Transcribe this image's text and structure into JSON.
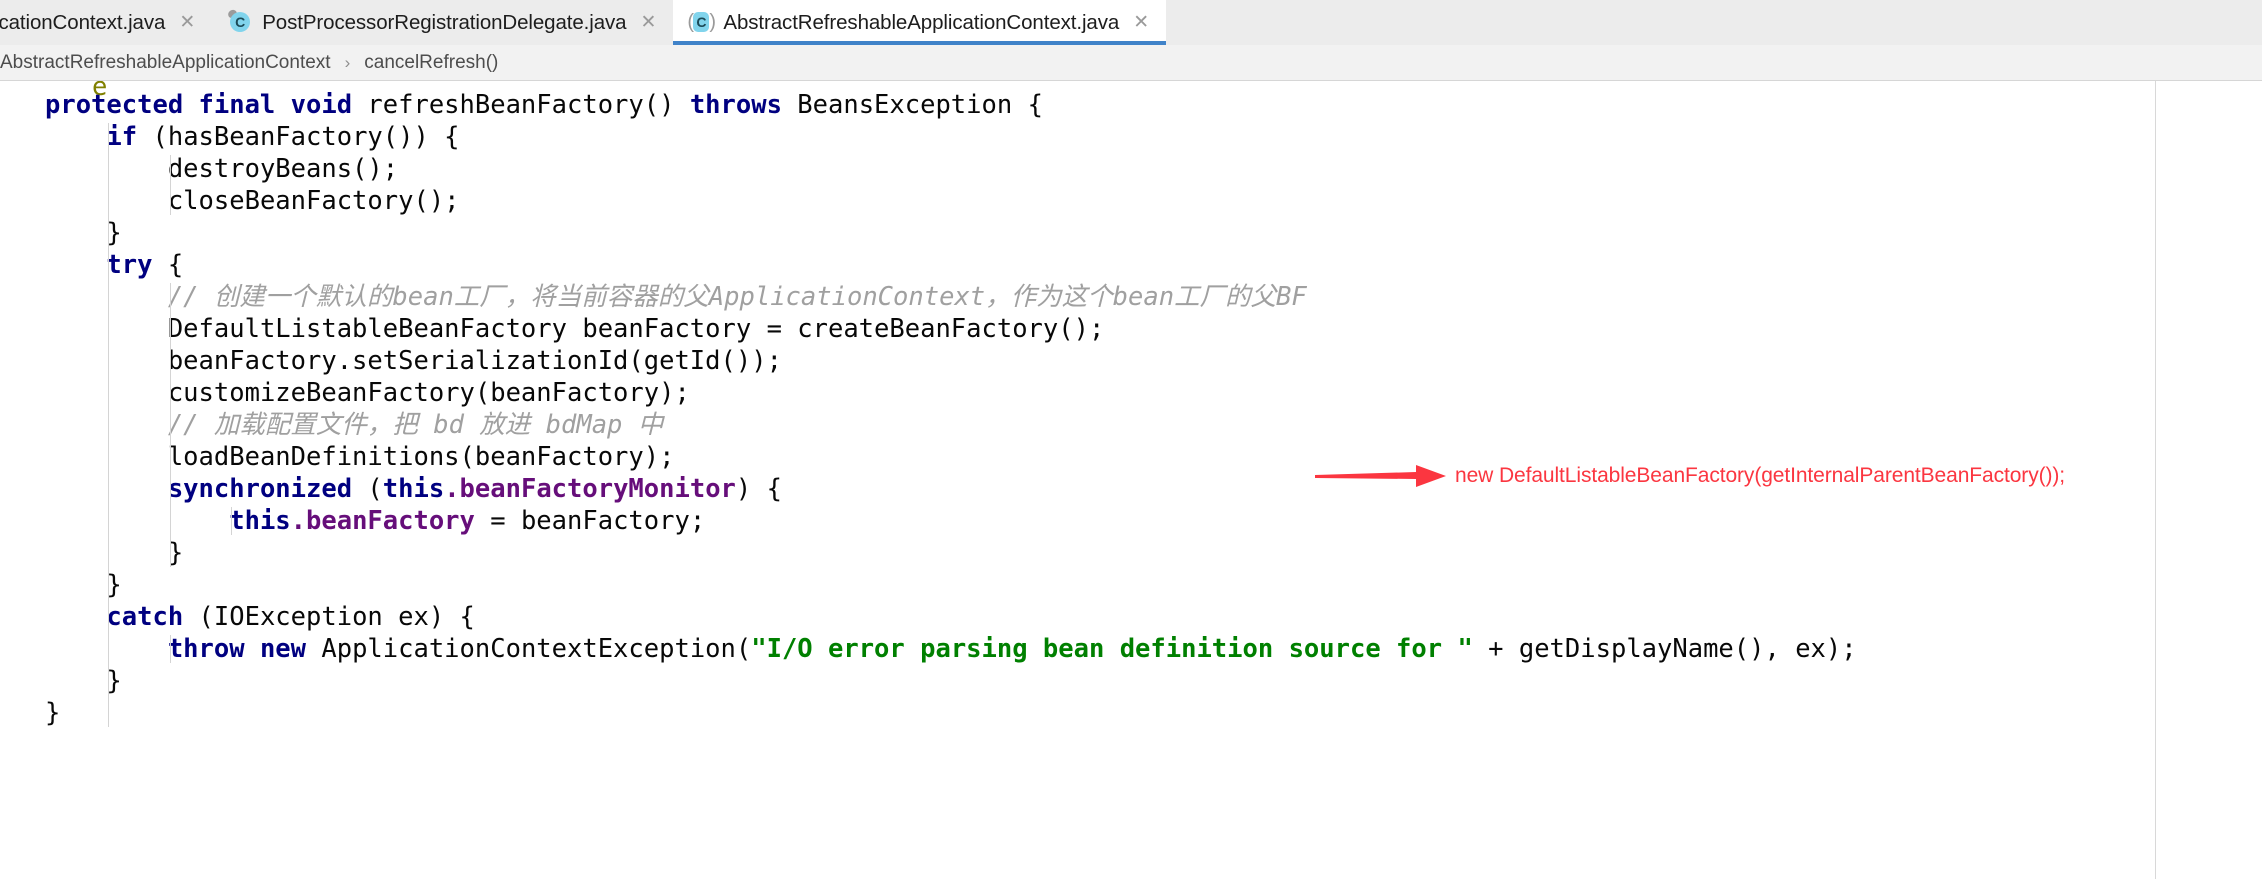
{
  "window": {
    "title": "AbstractRefreshableApplicationContext.java"
  },
  "tabs": [
    {
      "label": "icationContext.java",
      "icon": "java-class-icon",
      "close_label": "✕",
      "active": false,
      "clipped": true
    },
    {
      "label": "PostProcessorRegistrationDelegate.java",
      "icon": "java-class-icon",
      "close_label": "✕",
      "active": false,
      "clipped": false
    },
    {
      "label": "AbstractRefreshableApplicationContext.java",
      "icon": "java-abstract-class-icon",
      "close_label": "✕",
      "active": true,
      "clipped": false
    }
  ],
  "breadcrumb": {
    "separator": "›",
    "items": [
      "AbstractRefreshableApplicationContext",
      "cancelRefresh()"
    ]
  },
  "code": {
    "top_partial_glyph": "e",
    "lines": [
      {
        "indent": 0,
        "tokens": [
          {
            "t": "protected final void ",
            "c": "kw"
          },
          {
            "t": "refreshBeanFactory() ",
            "c": "plain"
          },
          {
            "t": "throws ",
            "c": "kw"
          },
          {
            "t": "BeansException {",
            "c": "plain"
          }
        ]
      },
      {
        "indent": 1,
        "tokens": [
          {
            "t": "if ",
            "c": "kw"
          },
          {
            "t": "(hasBeanFactory()) {",
            "c": "plain"
          }
        ]
      },
      {
        "indent": 2,
        "tokens": [
          {
            "t": "destroyBeans();",
            "c": "plain"
          }
        ]
      },
      {
        "indent": 2,
        "tokens": [
          {
            "t": "closeBeanFactory();",
            "c": "plain"
          }
        ]
      },
      {
        "indent": 1,
        "tokens": [
          {
            "t": "}",
            "c": "plain"
          }
        ]
      },
      {
        "indent": 1,
        "tokens": [
          {
            "t": "try ",
            "c": "kw"
          },
          {
            "t": "{",
            "c": "plain"
          }
        ]
      },
      {
        "indent": 2,
        "tokens": [
          {
            "t": "// 创建一个默认的bean工厂，将当前容器的父ApplicationContext，作为这个bean工厂的父BF",
            "c": "cmt"
          }
        ]
      },
      {
        "indent": 2,
        "tokens": [
          {
            "t": "DefaultListableBeanFactory beanFactory = createBeanFactory();",
            "c": "plain"
          }
        ]
      },
      {
        "indent": 2,
        "tokens": [
          {
            "t": "beanFactory.setSerializationId(getId());",
            "c": "plain"
          }
        ]
      },
      {
        "indent": 2,
        "tokens": [
          {
            "t": "customizeBeanFactory(beanFactory);",
            "c": "plain"
          }
        ]
      },
      {
        "indent": 2,
        "tokens": [
          {
            "t": "// 加载配置文件，把 bd 放进 bdMap 中",
            "c": "cmt"
          }
        ]
      },
      {
        "indent": 2,
        "tokens": [
          {
            "t": "loadBeanDefinitions(beanFactory);",
            "c": "plain"
          }
        ]
      },
      {
        "indent": 2,
        "tokens": [
          {
            "t": "synchronized ",
            "c": "kw"
          },
          {
            "t": "(",
            "c": "plain"
          },
          {
            "t": "this",
            "c": "kw"
          },
          {
            "t": ".beanFactoryMonitor",
            "c": "fld"
          },
          {
            "t": ") {",
            "c": "plain"
          }
        ]
      },
      {
        "indent": 3,
        "tokens": [
          {
            "t": "this",
            "c": "kw"
          },
          {
            "t": ".beanFactory ",
            "c": "fld"
          },
          {
            "t": "= beanFactory;",
            "c": "plain"
          }
        ]
      },
      {
        "indent": 2,
        "tokens": [
          {
            "t": "}",
            "c": "plain"
          }
        ]
      },
      {
        "indent": 1,
        "tokens": [
          {
            "t": "}",
            "c": "plain"
          }
        ]
      },
      {
        "indent": 1,
        "tokens": [
          {
            "t": "catch ",
            "c": "kw"
          },
          {
            "t": "(IOException ex) {",
            "c": "plain"
          }
        ]
      },
      {
        "indent": 2,
        "tokens": [
          {
            "t": "throw new ",
            "c": "kw"
          },
          {
            "t": "ApplicationContextException(",
            "c": "plain"
          },
          {
            "t": "\"I/O error parsing bean definition source for \"",
            "c": "str"
          },
          {
            "t": " + getDisplayName(), ex);",
            "c": "plain"
          }
        ]
      },
      {
        "indent": 1,
        "tokens": [
          {
            "t": "}",
            "c": "plain"
          }
        ]
      },
      {
        "indent": 0,
        "tokens": [
          {
            "t": "}",
            "c": "plain"
          }
        ]
      }
    ]
  },
  "annotation": {
    "text": "new DefaultListableBeanFactory(getInternalParentBeanFactory());",
    "color": "#fb3640",
    "arrow": "right-arrow-icon"
  },
  "colors": {
    "accent": "#4083c9",
    "tabbar_bg": "#ececec",
    "breadcrumb_bg": "#f2f2f2",
    "editor_bg": "#ffffff",
    "keyword": "#000080",
    "string": "#008000",
    "comment": "#a0a0a0",
    "field": "#660e7a",
    "annotation_red": "#fb3640",
    "class_icon": "#81d4ec"
  }
}
